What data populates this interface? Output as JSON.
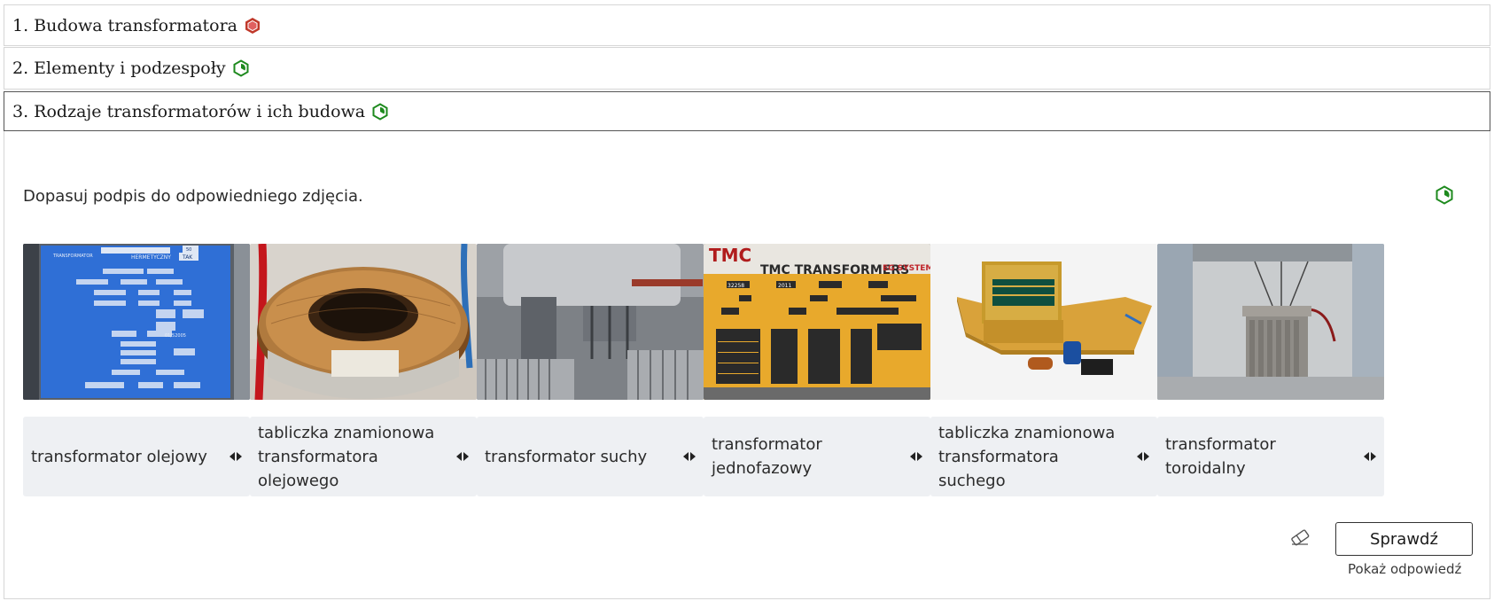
{
  "sections": [
    {
      "label": "1. Budowa transformatora",
      "status_icon": "red-hexagon-icon",
      "status_color": "#c0392b"
    },
    {
      "label": "2. Elementy i podzespoły",
      "status_icon": "green-hexagon-progress-icon",
      "status_color": "#1e8a1e"
    },
    {
      "label": "3. Rodzaje transformatorów i ich budowa",
      "status_icon": "green-hexagon-progress-icon",
      "status_color": "#1e8a1e"
    }
  ],
  "exercise": {
    "instruction": "Dopasuj podpis do odpowiedniego zdjęcia.",
    "images": [
      {
        "name": "nameplate-oil-photo",
        "alt": "blue nameplate photo",
        "nameplate": {
          "line1": "TRANSFORMATOR",
          "line2": "HERMETYCZNY",
          "value1": "TAK",
          "value2": "50",
          "code": "01/52005"
        }
      },
      {
        "name": "toroidal-photo",
        "alt": "toroidal transformer photo"
      },
      {
        "name": "dry-transformer-photo",
        "alt": "dry transformer photo"
      },
      {
        "name": "nameplate-dry-photo",
        "alt": "yellow nameplate photo",
        "plate": {
          "brand": "TMC",
          "title": "TMC TRANSFORMERS",
          "logo": "EG SYSTEM",
          "number": "32258",
          "year": "2011"
        }
      },
      {
        "name": "single-phase-photo",
        "alt": "single phase transformer photo"
      },
      {
        "name": "oil-transformer-photo",
        "alt": "oil transformer in substation photo"
      }
    ],
    "answers": [
      "transformator olejowy",
      "tabliczka znamionowa transformatora olejowego",
      "transformator suchy",
      "transformator jednofazowy",
      "tabliczka znamionowa transformatora suchego",
      "transformator toroidalny"
    ],
    "check_label": "Sprawdź",
    "show_answer_label": "Pokaż odpowiedź"
  },
  "colors": {
    "accent_green": "#1e8a1e",
    "accent_red": "#c0392b",
    "tile_bg": "#eef0f3"
  }
}
